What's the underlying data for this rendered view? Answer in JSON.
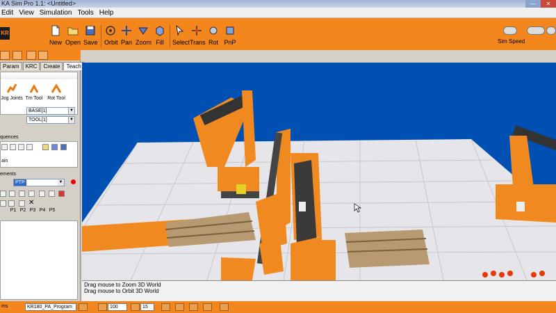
{
  "window": {
    "title": "KA Sim Pro 1.1: <Untitled>"
  },
  "menu": [
    "Edit",
    "View",
    "Simulation",
    "Tools",
    "Help"
  ],
  "logo_text": "KR",
  "toolbar": {
    "new": "New",
    "open": "Open",
    "save": "Save",
    "orbit": "Orbit",
    "pan": "Pan",
    "zoom": "Zoom",
    "fill": "Fill",
    "select": "Select",
    "trans": "Trans",
    "rot": "Rot",
    "pnp": "PnP",
    "sim_speed": "Sim Speed"
  },
  "left_tabs": [
    "Param",
    "KRC",
    "Create",
    "Teach"
  ],
  "teach": {
    "items": [
      "Jog Joints",
      "Tm Tool",
      "Rot Tool"
    ],
    "base_value": "BASE[1]",
    "tool_value": "TOOL[1]"
  },
  "sequences": {
    "label": "quences",
    "item": "ain"
  },
  "statements": {
    "label": "ements",
    "motion_type": "PTP"
  },
  "point_buttons": [
    "P1",
    "P2",
    "P3",
    "P4",
    "P5"
  ],
  "console": {
    "lines": [
      "Drag mouse to Zoom 3D World",
      "Drag mouse to Orbit 3D World"
    ]
  },
  "status": {
    "left_text": "ms",
    "program": "KR180_PA_Program",
    "field1": "100",
    "field2": "15"
  },
  "colors": {
    "accent": "#f3861d",
    "viewport_bg": "#0050b4"
  }
}
